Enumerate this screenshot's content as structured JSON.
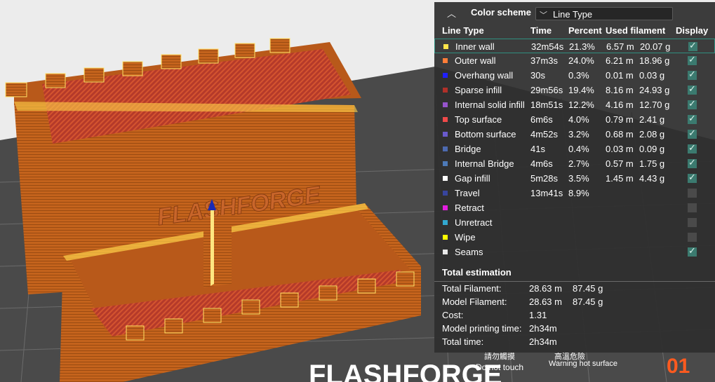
{
  "color_scheme": {
    "title": "Color scheme",
    "selected": "Line Type",
    "collapse_glyph": "︿",
    "chevron_glyph": "﹀"
  },
  "columns": {
    "line_type": "Line Type",
    "time": "Time",
    "percent": "Percent",
    "used_filament": "Used filament",
    "display": "Display"
  },
  "lines": [
    {
      "name": "Inner wall",
      "color": "#ffe54a",
      "time": "32m54s",
      "percent": "21.3%",
      "length": "6.57 m",
      "weight": "20.07 g",
      "display": true
    },
    {
      "name": "Outer wall",
      "color": "#ff7d38",
      "time": "37m3s",
      "percent": "24.0%",
      "length": "6.21 m",
      "weight": "18.96 g",
      "display": true
    },
    {
      "name": "Overhang wall",
      "color": "#1f1fff",
      "time": "30s",
      "percent": "0.3%",
      "length": "0.01 m",
      "weight": "0.03 g",
      "display": true
    },
    {
      "name": "Sparse infill",
      "color": "#b03029",
      "time": "29m56s",
      "percent": "19.4%",
      "length": "8.16 m",
      "weight": "24.93 g",
      "display": true
    },
    {
      "name": "Internal solid infill",
      "color": "#9654cc",
      "time": "18m51s",
      "percent": "12.2%",
      "length": "4.16 m",
      "weight": "12.70 g",
      "display": true
    },
    {
      "name": "Top surface",
      "color": "#f04a4a",
      "time": "6m6s",
      "percent": "4.0%",
      "length": "0.79 m",
      "weight": "2.41 g",
      "display": true
    },
    {
      "name": "Bottom surface",
      "color": "#6a5acd",
      "time": "4m52s",
      "percent": "3.2%",
      "length": "0.68 m",
      "weight": "2.08 g",
      "display": true
    },
    {
      "name": "Bridge",
      "color": "#4d6ab0",
      "time": "41s",
      "percent": "0.4%",
      "length": "0.03 m",
      "weight": "0.09 g",
      "display": true
    },
    {
      "name": "Internal Bridge",
      "color": "#4d7ab8",
      "time": "4m6s",
      "percent": "2.7%",
      "length": "0.57 m",
      "weight": "1.75 g",
      "display": true
    },
    {
      "name": "Gap infill",
      "color": "#ffffff",
      "time": "5m28s",
      "percent": "3.5%",
      "length": "1.45 m",
      "weight": "4.43 g",
      "display": true
    },
    {
      "name": "Travel",
      "color": "#38459e",
      "time": "13m41s",
      "percent": "8.9%",
      "length": "",
      "weight": "",
      "display": false
    },
    {
      "name": "Retract",
      "color": "#e31ee0",
      "time": "",
      "percent": "",
      "length": "",
      "weight": "",
      "display": false
    },
    {
      "name": "Unretract",
      "color": "#32a8d0",
      "time": "",
      "percent": "",
      "length": "",
      "weight": "",
      "display": false
    },
    {
      "name": "Wipe",
      "color": "#ffff00",
      "time": "",
      "percent": "",
      "length": "",
      "weight": "",
      "display": false
    },
    {
      "name": "Seams",
      "color": "#e8e8e8",
      "time": "",
      "percent": "",
      "length": "",
      "weight": "",
      "display": true
    }
  ],
  "total_estimation": {
    "title": "Total estimation",
    "rows": [
      {
        "label": "Total Filament:",
        "length": "28.63 m",
        "weight": "87.45 g"
      },
      {
        "label": "Model Filament:",
        "length": "28.63 m",
        "weight": "87.45 g"
      },
      {
        "label": "Cost:",
        "length": "1.31",
        "weight": ""
      },
      {
        "label": "Model printing time:",
        "length": "2h34m",
        "weight": ""
      },
      {
        "label": "Total time:",
        "length": "2h34m",
        "weight": ""
      }
    ]
  },
  "viewport": {
    "logo_text": "FLASHFORGE",
    "plate_label": "01",
    "warning_cn_1": "請勿觸摸",
    "warning_en_1": "Do not touch",
    "warning_cn_2": "高溫危險",
    "warning_en_2": "Warning hot surface",
    "model_color": "#c8651c"
  }
}
